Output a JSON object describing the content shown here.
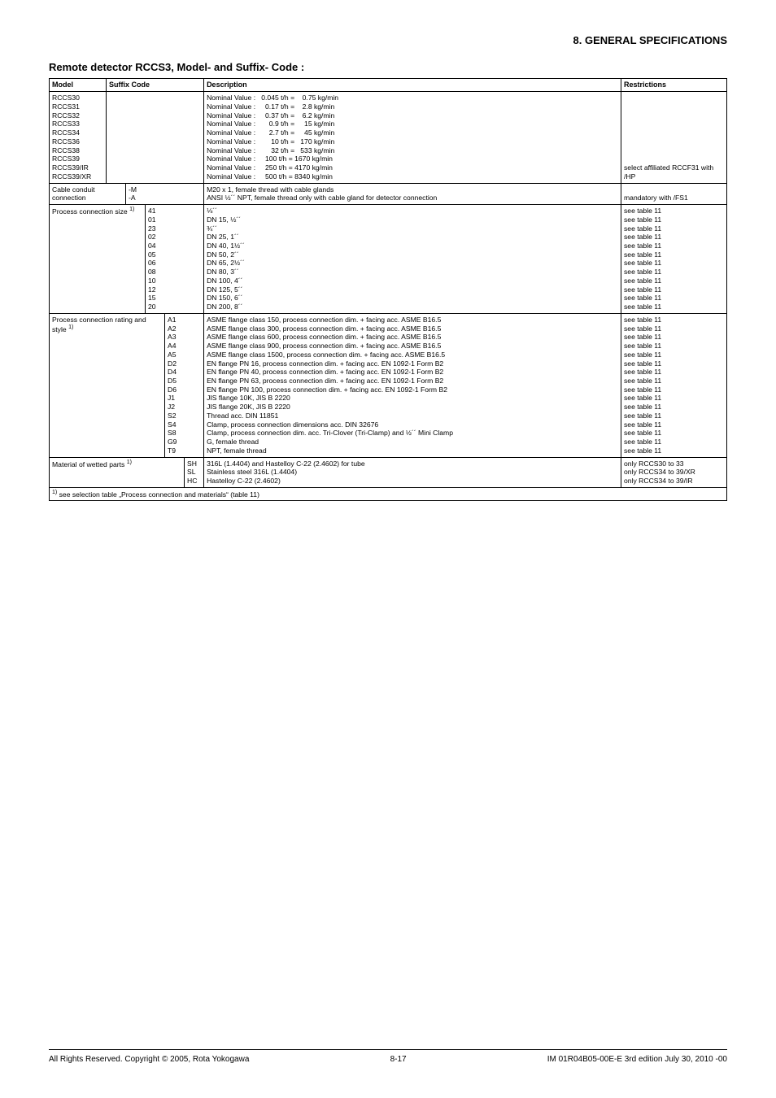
{
  "header": {
    "section": "8.  GENERAL SPECIFICATIONS"
  },
  "title": "Remote detector RCCS3, Model- and Suffix- Code :",
  "th": {
    "model": "Model",
    "suffix": "Suffix Code",
    "desc": "Description",
    "restr": "Restrictions"
  },
  "models": {
    "list": "RCCS30\nRCCS31\nRCCS32\nRCCS33\nRCCS34\nRCCS36\nRCCS38\nRCCS39\nRCCS39/IR\nRCCS39/XR",
    "desc": "Nominal Value :   0.045 t/h =    0.75 kg/min\nNominal Value :     0.17 t/h =    2.8 kg/min\nNominal Value :     0.37 t/h =    6.2 kg/min\nNominal Value :       0.9 t/h =     15 kg/min\nNominal Value :       2.7 t/h =     45 kg/min\nNominal Value :        10 t/h =   170 kg/min\nNominal Value :        32 t/h =   533 kg/min\nNominal Value :     100 t/h = 1670 kg/min\nNominal Value :     250 t/h = 4170 kg/min\nNominal Value :     500 t/h = 8340 kg/min",
    "restr": "select affiliated RCCF31 with /HP"
  },
  "cable": {
    "label": "Cable conduit connection",
    "codes": "-M\n-A",
    "desc": "M20 x 1, female thread with cable glands\nANSI ½´´ NPT, female thread only with cable gland for detector connection",
    "restr": "mandatory with /FS1"
  },
  "procsize": {
    "label": "Process connection size ",
    "sup": "1)",
    "codes": "41\n01\n23\n02\n04\n05\n06\n08\n10\n12\n15\n20",
    "desc": "⅛´´\nDN 15, ½´´\n¾´´\nDN 25, 1´´\nDN 40, 1½´´\nDN 50, 2´´\nDN 65, 2½´´\nDN 80, 3´´\nDN 100, 4´´\nDN 125, 5´´\nDN 150, 6´´\nDN 200, 8´´",
    "restr": "see table 11\nsee table 11\nsee table 11\nsee table 11\nsee table 11\nsee table 11\nsee table 11\nsee table 11\nsee table 11\nsee table 11\nsee table 11\nsee table 11"
  },
  "procstyle": {
    "label": "Process connection rating and style ",
    "sup": "1)",
    "codes": "A1\nA2\nA3\nA4\nA5\nD2\nD4\nD5\nD6\nJ1\nJ2\nS2\nS4\nS8\nG9\nT9",
    "desc": "ASME flange class 150, process connection dim. + facing acc. ASME B16.5\nASME flange class 300, process connection dim. + facing acc. ASME B16.5\nASME flange class 600, process connection dim. + facing acc. ASME B16.5\nASME flange class 900, process connection dim. + facing acc. ASME B16.5\nASME flange class 1500, process connection dim. + facing acc. ASME B16.5\nEN flange PN 16, process connection dim. + facing acc. EN 1092-1 Form B2\nEN flange PN 40, process connection dim. + facing acc. EN 1092-1 Form B2\nEN flange PN 63, process connection dim. + facing acc. EN 1092-1 Form B2\nEN flange PN 100, process connection dim. + facing acc. EN 1092-1 Form B2\nJIS flange 10K, JIS B 2220\nJIS flange 20K, JIS B 2220\nThread acc. DIN 11851\nClamp, process connection dimensions acc. DIN 32676\nClamp, process connection dim. acc. Tri-Clover (Tri-Clamp) and ½´´ Mini Clamp\nG, female thread\nNPT, female thread",
    "restr": "see table 11\nsee table 11\nsee table 11\nsee table 11\nsee table 11\nsee table 11\nsee table 11\nsee table 11\nsee table 11\nsee table 11\nsee table 11\nsee table 11\nsee table 11\nsee table 11\nsee table 11\nsee table 11"
  },
  "material": {
    "label": "Material of wetted parts  ",
    "sup": "1)",
    "codes": "SH\nSL\nHC",
    "desc": "316L (1.4404) and Hastelloy C-22 (2.4602) for tube\nStainless steel 316L (1.4404)\nHastelloy C-22 (2.4602)",
    "restr": "only RCCS30 to 33\nonly RCCS34 to 39/XR\nonly RCCS34 to 39/IR"
  },
  "footnote": {
    "sup": "1)",
    "text": " see selection table „Process connection and materials“ (table 11)"
  },
  "footer": {
    "left": "All Rights Reserved. Copyright © 2005, Rota Yokogawa",
    "center": "8-17",
    "right": "IM 01R04B05-00E-E    3rd edition July 30, 2010 -00"
  }
}
